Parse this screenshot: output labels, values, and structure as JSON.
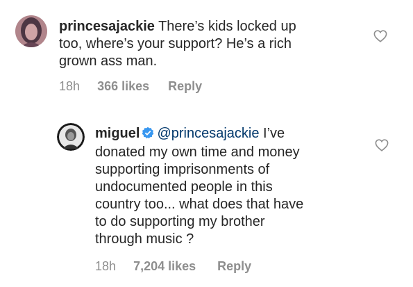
{
  "comments": [
    {
      "username": "princesajackie",
      "text_lines": [
        "There’s kids locked up",
        "too, where’s your support? He’s a rich",
        "grown ass man."
      ],
      "time": "18h",
      "likes": "366 likes",
      "reply": "Reply",
      "heart_icon": "heart-outline-icon"
    },
    {
      "username": "miguel",
      "verified": true,
      "mention": "@princesajackie",
      "text_first": "I’ve",
      "text_lines": [
        "donated my own time and money",
        "supporting imprisonments of",
        "undocumented people in this",
        "country too... what does that have",
        "to do supporting my brother",
        "through music ?"
      ],
      "time": "18h",
      "likes": "7,204 likes",
      "reply": "Reply",
      "heart_icon": "heart-outline-icon"
    }
  ],
  "colors": {
    "text": "#262626",
    "meta": "#8e8e8e",
    "mention": "#00376b",
    "verified": "#3897f0"
  }
}
